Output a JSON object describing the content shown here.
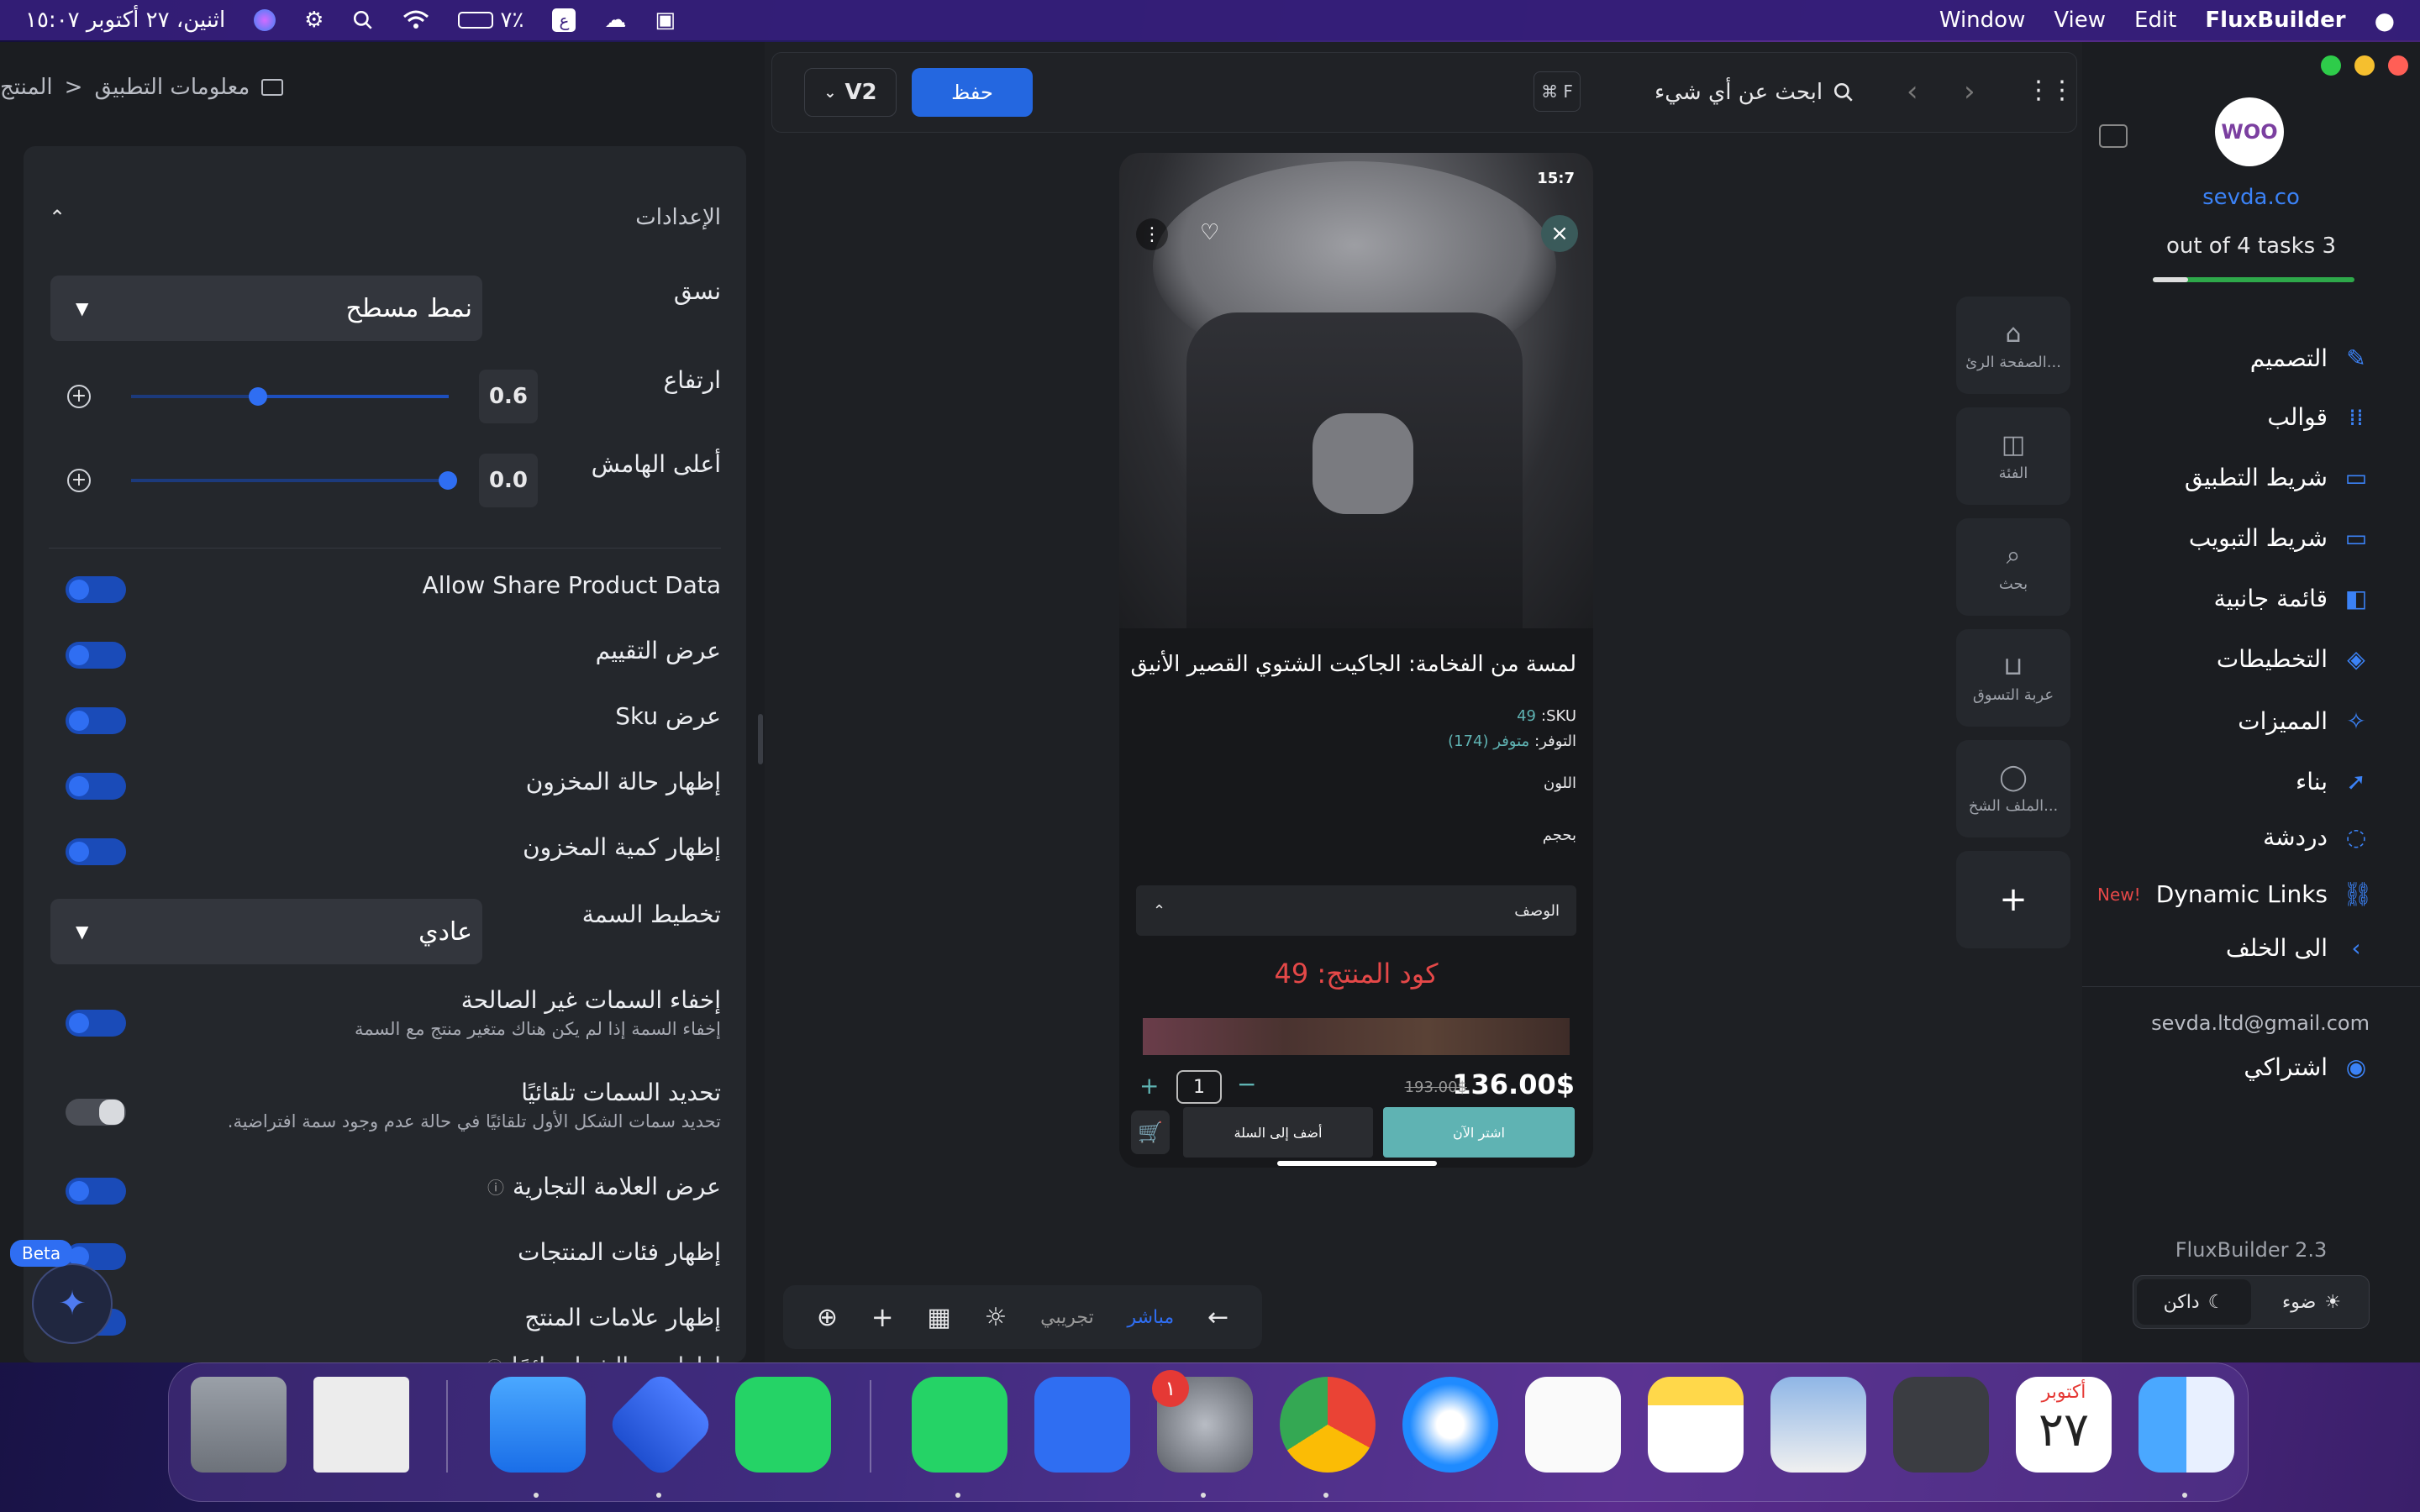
{
  "menubar": {
    "clock": "اثنين، ٢٧ أكتوبر ١٥:٠٧",
    "battery": "٧٪",
    "keyboard": "ع",
    "apple": "",
    "app_name": "FluxBuilder",
    "menus": [
      "Edit",
      "View",
      "Window"
    ]
  },
  "left_panel": {
    "breadcrumb_parent": "معلومات التطبيق",
    "breadcrumb_sep": ">",
    "breadcrumb_current": "المنتج",
    "section_title": "الإعدادات",
    "style_label": "نسق",
    "style_value": "نمط مسطح",
    "height_label": "ارتفاع",
    "height_value": "0.6",
    "height_level": 0.4,
    "margin_label": "أعلى الهامش",
    "margin_value": "0.0",
    "margin_level": 0.98,
    "toggles": [
      {
        "label": "Allow Share Product Data",
        "on": true
      },
      {
        "label": "عرض التقييم",
        "on": true
      },
      {
        "label": "عرض Sku",
        "on": true
      },
      {
        "label": "إظهار حالة المخزون",
        "on": true
      },
      {
        "label": "إظهار كمية المخزون",
        "on": true
      }
    ],
    "attr_layout_label": "تخطيط السمة",
    "attr_layout_value": "عادي",
    "hide_invalid_label": "إخفاء السمات غير الصالحة",
    "hide_invalid_sub": "إخفاء السمة إذا لم يكن هناك متغير منتج مع السمة",
    "auto_select_label": "تحديد السمات تلقائيًا",
    "auto_select_sub": "تحديد سمات الشكل الأول تلقائيًا في حالة عدم وجود سمة افتراضية.",
    "brand_label": "عرض العلامة التجارية",
    "categories_label": "إظهار فئات المنتجات",
    "tags_label": "إظهار علامات المنتج",
    "always_buy_label": "إظهار زر الشراء دائمًا",
    "beta": "Beta"
  },
  "toolbar": {
    "version": "V2",
    "save": "حفظ",
    "shortcut": "⌘ F",
    "search_placeholder": "ابحث عن أي شيء"
  },
  "phone": {
    "time": "15:7",
    "title": "لمسة من الفخامة: الجاكيت الشتوي القصير الأنيق",
    "sku_label": "SKU:",
    "sku_value": "49",
    "avail_label": "التوفر:",
    "avail_value": "متوفر (174)",
    "color_label": "اللون",
    "size_label": "بحجم",
    "desc_label": "الوصف",
    "code_text": "كود المنتج: 49",
    "price": "136.00$",
    "old_price": "193.00$",
    "qty": "1",
    "add_cart": "أضف إلى السلة",
    "buy_now": "اشتر الآن"
  },
  "side_buttons": [
    {
      "icon": "home-icon",
      "label": "الصفحة الرئ..."
    },
    {
      "icon": "category-icon",
      "label": "الفئة"
    },
    {
      "icon": "search-icon",
      "label": "بحث"
    },
    {
      "icon": "cart-icon",
      "label": "عربة التسوق"
    },
    {
      "icon": "profile-icon",
      "label": "الملف الشخ..."
    }
  ],
  "bottom_bar": {
    "live": "مباشر",
    "demo": "تجريبي"
  },
  "right_nav": {
    "logo_text": "WOO",
    "site": "sevda.co",
    "tasks": "3 out of 4 tasks",
    "tasks_progress": 0.75,
    "items": [
      {
        "label": "التصميم"
      },
      {
        "label": "قوالب"
      },
      {
        "label": "شريط التطبيق"
      },
      {
        "label": "شريط التبويب"
      },
      {
        "label": "قائمة جانبية"
      },
      {
        "label": "التخطيطات"
      },
      {
        "label": "المميزات"
      },
      {
        "label": "بناء"
      },
      {
        "label": "دردشة"
      },
      {
        "label": "Dynamic Links",
        "badge": "New!"
      },
      {
        "label": "الى الخلف"
      }
    ],
    "email": "sevda.ltd@gmail.com",
    "subscription": "اشتراكي",
    "version": "FluxBuilder 2.3",
    "light": "ضوء",
    "dark": "داكن"
  },
  "dock": {
    "calendar_month": "أكتوبر",
    "calendar_day": "٢٧",
    "badge": "١"
  },
  "colors": {
    "accent": "#2f6ef2",
    "buy": "#5fb3b3",
    "price_red": "#e54848"
  }
}
